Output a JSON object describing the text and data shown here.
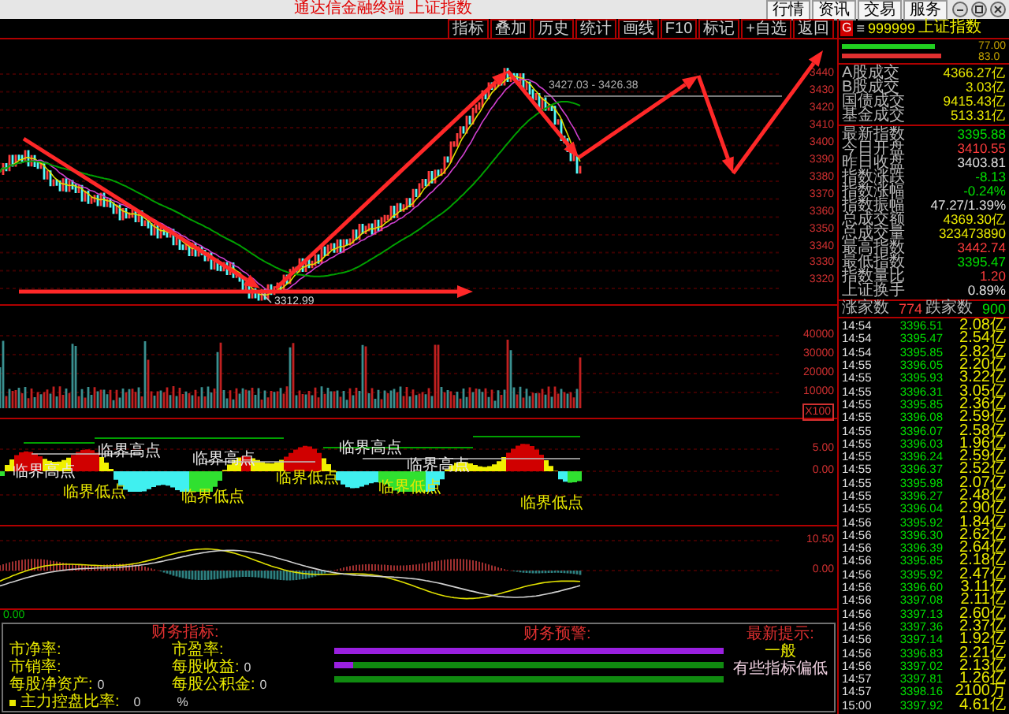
{
  "window": {
    "title": "通达信金融终端 上证指数",
    "menu": [
      "行情",
      "资讯",
      "交易",
      "服务"
    ]
  },
  "toolbar": {
    "buttons": [
      "指标",
      "叠加",
      "历史",
      "统计",
      "画线",
      "F10",
      "标记",
      "+自选",
      "返回"
    ]
  },
  "main_chart": {
    "price_axis": [
      "3440",
      "3430",
      "3420",
      "3410",
      "3400",
      "3390",
      "3380",
      "3370",
      "3360",
      "3350",
      "3340",
      "3330",
      "3320"
    ],
    "range_label": "3427.03 - 3426.38",
    "low_label": "3312.99"
  },
  "volume_chart": {
    "axis": [
      "40000",
      "30000",
      "20000",
      "10000"
    ],
    "unit": "X100"
  },
  "signal_chart": {
    "axis": [
      "5.00",
      "0.00"
    ],
    "markers": [
      {
        "text": "临界高点",
        "kind": "high"
      },
      {
        "text": "临界高点",
        "kind": "high"
      },
      {
        "text": "临界低点",
        "kind": "low"
      },
      {
        "text": "临界低点",
        "kind": "low"
      },
      {
        "text": "临界高点",
        "kind": "high"
      },
      {
        "text": "临界低点",
        "kind": "low"
      },
      {
        "text": "临界高点",
        "kind": "high"
      },
      {
        "text": "临界高点",
        "kind": "high"
      },
      {
        "text": "临界低点",
        "kind": "low"
      },
      {
        "text": "临界低点",
        "kind": "low"
      }
    ]
  },
  "macd_chart": {
    "axis": [
      "10.50",
      "0.00"
    ],
    "bottom_value": "0.00"
  },
  "fund_panel": {
    "title": "财务指标:",
    "items": [
      {
        "label": "市净率:"
      },
      {
        "label": "市盈率:"
      },
      {
        "label": "市销率:"
      },
      {
        "label": "每股收益:",
        "value": "0"
      },
      {
        "label": "每股净资产:",
        "value": "0"
      },
      {
        "label": "每股公积金:",
        "value": "0"
      }
    ],
    "holding": {
      "label": "主力控盘比率:",
      "value": "0",
      "unit": "%"
    },
    "warning_title": "财务预警:",
    "tip_title": "最新提示:",
    "tip_level": "一般",
    "tip_text": "有些指标偏低"
  },
  "quote_panel": {
    "badge": "G",
    "menu_glyph": "≡",
    "code": "999999",
    "name": "上证指数",
    "bar_values": [
      "77.00",
      "83.0"
    ],
    "turnover": [
      {
        "label": "A股成交",
        "value": "4366.27亿",
        "color": "#e8e800"
      },
      {
        "label": "B股成交",
        "value": "3.03亿",
        "color": "#e8e800"
      },
      {
        "label": "国债成交",
        "value": "9415.43亿",
        "color": "#e8e800"
      },
      {
        "label": "基金成交",
        "value": "513.31亿",
        "color": "#e8e800"
      }
    ],
    "stats": [
      {
        "label": "最新指数",
        "value": "3395.88",
        "color": "#00e000"
      },
      {
        "label": "今日开盘",
        "value": "3410.55",
        "color": "#ff3c3c"
      },
      {
        "label": "昨日收盘",
        "value": "3403.81",
        "color": "#e0e0e0"
      },
      {
        "label": "指数涨跌",
        "value": "-8.13",
        "color": "#00e000"
      },
      {
        "label": "指数涨幅",
        "value": "-0.24%",
        "color": "#00e000"
      },
      {
        "label": "指数振幅",
        "value": "47.27/1.39%",
        "color": "#e0e0e0"
      },
      {
        "label": "总成交额",
        "value": "4369.30亿",
        "color": "#e8e800"
      },
      {
        "label": "总成交量",
        "value": "323473890",
        "color": "#e8e800"
      },
      {
        "label": "最高指数",
        "value": "3442.74",
        "color": "#ff3c3c"
      },
      {
        "label": "最低指数",
        "value": "3395.47",
        "color": "#00e000"
      },
      {
        "label": "指数量比",
        "value": "1.20",
        "color": "#ff3c3c"
      },
      {
        "label": "上证换手",
        "value": "0.89%",
        "color": "#e0e0e0"
      }
    ],
    "breadth": {
      "up_label": "涨家数",
      "up_count": "774",
      "down_label": "跌家数",
      "down_count": "900"
    },
    "ticks": [
      [
        "14:54",
        "3396.51",
        "2.08亿"
      ],
      [
        "14:54",
        "3395.47",
        "2.54亿"
      ],
      [
        "14:54",
        "3395.85",
        "2.82亿"
      ],
      [
        "14:55",
        "3396.05",
        "2.20亿"
      ],
      [
        "14:55",
        "3395.93",
        "3.22亿"
      ],
      [
        "14:55",
        "3396.31",
        "3.05亿"
      ],
      [
        "14:55",
        "3395.85",
        "2.36亿"
      ],
      [
        "14:55",
        "3396.08",
        "2.59亿"
      ],
      [
        "14:55",
        "3396.07",
        "2.58亿"
      ],
      [
        "14:55",
        "3396.03",
        "1.96亿"
      ],
      [
        "14:55",
        "3396.24",
        "2.59亿"
      ],
      [
        "14:55",
        "3396.37",
        "2.52亿"
      ],
      [
        "14:55",
        "3395.98",
        "2.07亿"
      ],
      [
        "14:55",
        "3396.27",
        "2.48亿"
      ],
      [
        "14:55",
        "3396.04",
        "2.90亿"
      ],
      [
        "14:56",
        "3395.92",
        "1.84亿"
      ],
      [
        "14:56",
        "3396.30",
        "2.62亿"
      ],
      [
        "14:56",
        "3396.39",
        "2.64亿"
      ],
      [
        "14:56",
        "3395.85",
        "2.18亿"
      ],
      [
        "14:56",
        "3395.92",
        "2.47亿"
      ],
      [
        "14:56",
        "3396.60",
        "3.11亿"
      ],
      [
        "14:56",
        "3397.08",
        "2.11亿"
      ],
      [
        "14:56",
        "3397.13",
        "2.60亿"
      ],
      [
        "14:56",
        "3397.36",
        "2.37亿"
      ],
      [
        "14:56",
        "3397.14",
        "1.92亿"
      ],
      [
        "14:56",
        "3396.83",
        "2.21亿"
      ],
      [
        "14:56",
        "3397.02",
        "2.13亿"
      ],
      [
        "14:57",
        "3397.81",
        "1.26亿"
      ],
      [
        "14:57",
        "3398.16",
        "2100万"
      ],
      [
        "15:00",
        "3397.92",
        "4.61亿"
      ]
    ]
  }
}
